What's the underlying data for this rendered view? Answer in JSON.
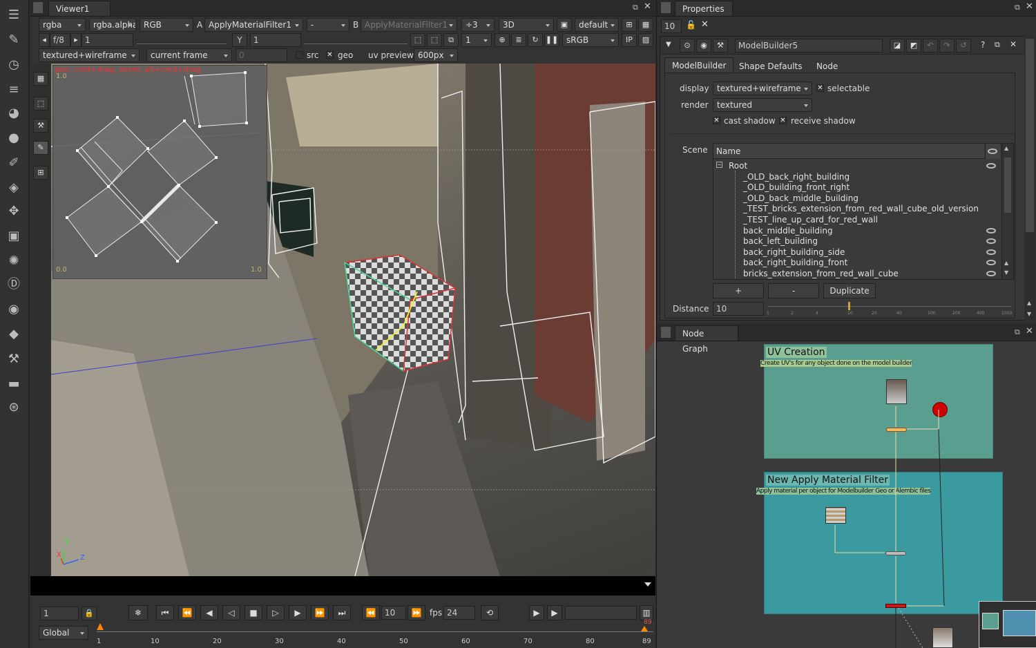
{
  "viewer": {
    "tab": "Viewer1",
    "channels": "rgba",
    "alpha": "rgba.alpha",
    "colorspace": "RGB",
    "a_label": "A",
    "a_input": "ApplyMaterialFilter1",
    "a_op": "-",
    "b_label": "B",
    "b_input": "ApplyMaterialFilter1",
    "downrez": "÷3",
    "view_mode": "3D",
    "camera": "default",
    "fstop": "f/8",
    "exposure": "1",
    "y_label": "Y",
    "gamma": "1",
    "proxy": "1",
    "lut": "sRGB",
    "ip": "IP",
    "display_mode": "textured+wireframe",
    "frame_mode": "current frame",
    "frame_field": "0",
    "src_label": "src",
    "geo_label": "geo",
    "uv_preview_label": "uv preview",
    "uv_size": "600px",
    "uv_hint": "pan: cmd+drag, zoom: alt+cmd+drag",
    "uv_top": "1.0",
    "uv_bl": "0.0",
    "uv_br": "1.0",
    "axis_y": "Y",
    "axis_x": "X",
    "axis_z": "Z"
  },
  "timeline": {
    "frame": "1",
    "current": "10",
    "fps_label": "fps",
    "fps": "24",
    "range": "Global",
    "ticks": [
      "1",
      "10",
      "20",
      "30",
      "40",
      "50",
      "60",
      "70",
      "80",
      "89"
    ],
    "end_frame": "89"
  },
  "properties": {
    "title": "Properties",
    "max_panels": "10",
    "node_name": "ModelBuilder5",
    "tabs": [
      "ModelBuilder",
      "Shape Defaults",
      "Node"
    ],
    "display_label": "display",
    "display_value": "textured+wireframe",
    "selectable_label": "selectable",
    "render_label": "render",
    "render_value": "textured",
    "cast_shadow_label": "cast shadow",
    "receive_shadow_label": "receive shadow",
    "scene_label": "Scene",
    "name_header": "Name",
    "root": "Root",
    "items": [
      "_OLD_back_right_building",
      "_OLD_building_front_right",
      "_OLD_back_middle_building",
      "_TEST_bricks_extension_from_red_wall_cube_old_version",
      "_TEST_line_up_card_for_red_wall",
      "back_middle_building",
      "back_left_building",
      "back_right_building_side",
      "back_right_building_front",
      "bricks_extension_from_red_wall_cube"
    ],
    "btn_add": "+",
    "btn_remove": "-",
    "btn_duplicate": "Duplicate",
    "distance_label": "Distance",
    "distance_value": "10",
    "slider_ticks": [
      "1",
      "2",
      "4",
      "10",
      "20",
      "40",
      "100",
      "200",
      "400",
      "1000"
    ]
  },
  "node_graph": {
    "title": "Node Graph",
    "backdrops": [
      {
        "title": "UV Creation",
        "note": "Create UV's for any object done on the model builder",
        "color": "#5a9e8f"
      },
      {
        "title": "New Apply Material Filter",
        "note": "Apply material per object for Modelbuilder Geo or Alembic files",
        "color": "#3a9aa0"
      }
    ]
  }
}
